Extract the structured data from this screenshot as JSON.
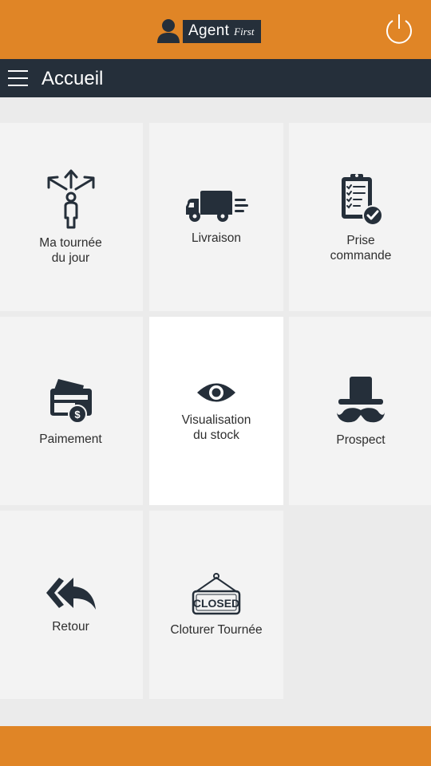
{
  "header": {
    "brand": "Agent",
    "brand_sub": "First",
    "brand_color": "#e08526",
    "user_icon": "user-icon",
    "power_icon": "power-icon"
  },
  "nav": {
    "menu_icon": "hamburger-icon",
    "title": "Accueil",
    "bar_color": "#252f3a"
  },
  "tiles": [
    {
      "label": "Ma tournée\ndu jour",
      "icon": "directions-person-icon"
    },
    {
      "label": "Livraison",
      "icon": "delivery-truck-icon"
    },
    {
      "label": "Prise\ncommande",
      "icon": "clipboard-check-icon"
    },
    {
      "label": "Paimement",
      "icon": "payment-cards-icon"
    },
    {
      "label": "Visualisation\ndu stock",
      "icon": "eye-icon",
      "selected": true
    },
    {
      "label": "Prospect",
      "icon": "hat-mustache-icon"
    },
    {
      "label": "Retour",
      "icon": "reply-all-icon"
    },
    {
      "label": "Cloturer Tournée",
      "icon": "closed-sign-icon",
      "sign_text": "CLOSED"
    }
  ]
}
